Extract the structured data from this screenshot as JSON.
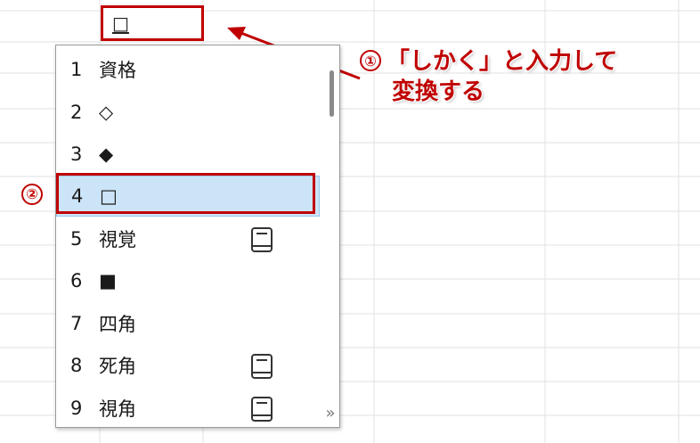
{
  "cell": {
    "input_text": "□"
  },
  "callout": {
    "num": "①",
    "line1": "「しかく」と入力して",
    "line2": "変換する"
  },
  "badge2": {
    "num": "②"
  },
  "candidates": [
    {
      "index": "1",
      "text": "資格",
      "dictionary": false,
      "selected": false
    },
    {
      "index": "2",
      "text": "◇",
      "dictionary": false,
      "selected": false
    },
    {
      "index": "3",
      "text": "◆",
      "dictionary": false,
      "selected": false
    },
    {
      "index": "4",
      "text": "□",
      "dictionary": false,
      "selected": true
    },
    {
      "index": "5",
      "text": "視覚",
      "dictionary": true,
      "selected": false
    },
    {
      "index": "6",
      "text": "■",
      "dictionary": false,
      "selected": false
    },
    {
      "index": "7",
      "text": "四角",
      "dictionary": false,
      "selected": false
    },
    {
      "index": "8",
      "text": "死角",
      "dictionary": true,
      "selected": false
    },
    {
      "index": "9",
      "text": "視角",
      "dictionary": true,
      "selected": false
    }
  ],
  "expand_label": "»",
  "colors": {
    "annotation": "#c00000",
    "selection": "#cce4f7",
    "grid": "#e1e1e1"
  }
}
